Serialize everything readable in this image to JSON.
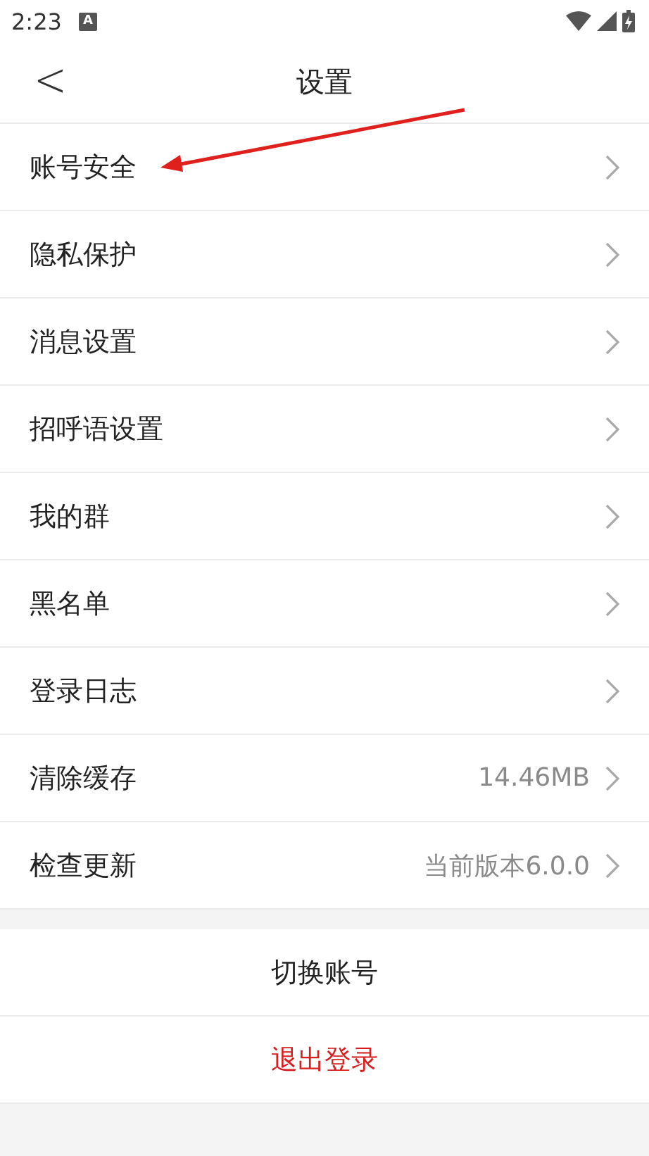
{
  "status_bar": {
    "time": "2:23",
    "notification": "A"
  },
  "header": {
    "back": "<",
    "title": "设置"
  },
  "items": [
    {
      "label": "账号安全"
    },
    {
      "label": "隐私保护"
    },
    {
      "label": "消息设置"
    },
    {
      "label": "招呼语设置"
    },
    {
      "label": "我的群"
    },
    {
      "label": "黑名单"
    },
    {
      "label": "登录日志"
    },
    {
      "label": "清除缓存",
      "value": "14.46MB"
    },
    {
      "label": "检查更新",
      "value": "当前版本6.0.0"
    }
  ],
  "actions": [
    {
      "label": "切换账号",
      "kind": "normal"
    },
    {
      "label": "退出登录",
      "kind": "danger"
    }
  ]
}
